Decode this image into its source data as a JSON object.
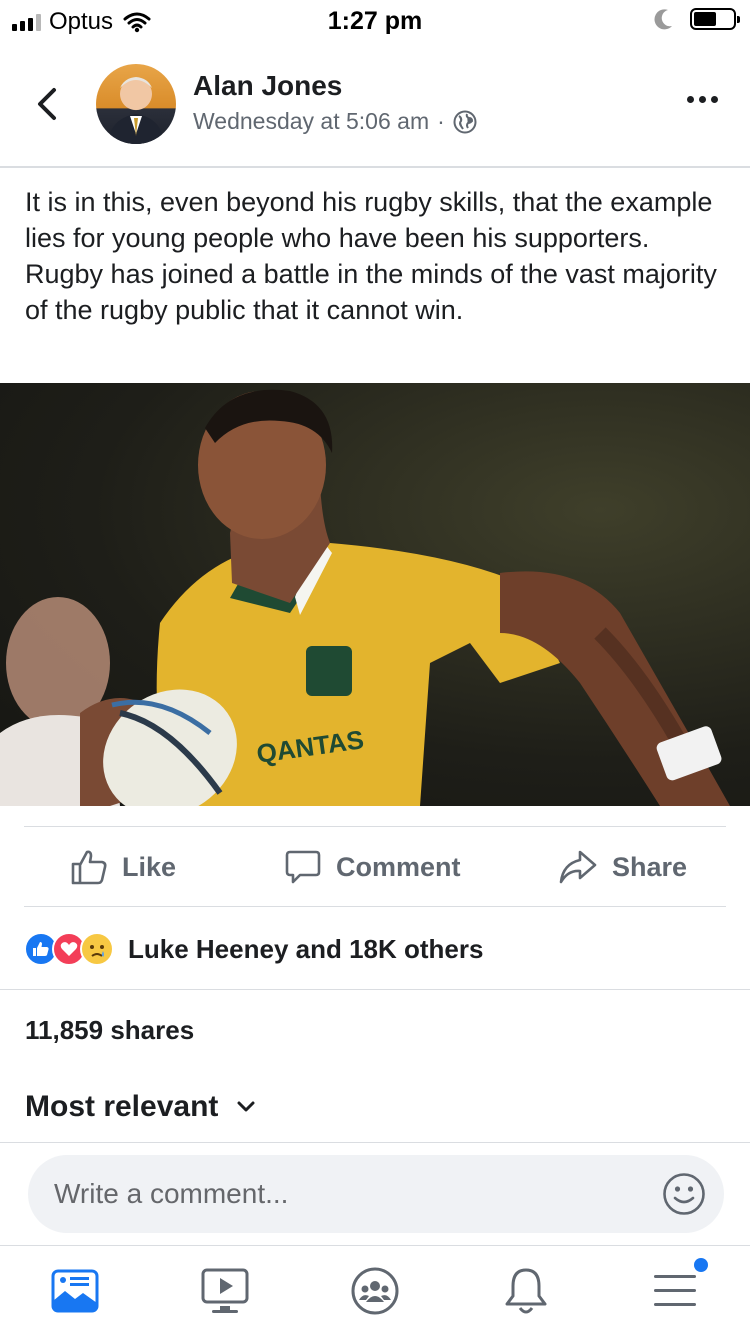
{
  "status_bar": {
    "carrier": "Optus",
    "time": "1:27 pm"
  },
  "post": {
    "author": "Alan Jones",
    "timestamp": "Wednesday at 5:06 am",
    "separator": "·",
    "text": "It is in this, even beyond his rugby skills, that the example lies for young people who have been his supporters. Rugby has joined a battle in the minds of the vast majority of the rugby public that it cannot win.",
    "photo_label": "QANTAS"
  },
  "actions": {
    "like": "Like",
    "comment": "Comment",
    "share": "Share"
  },
  "reactions": {
    "summary": "Luke Heeney and 18K others",
    "icons": [
      "like-reaction-icon",
      "love-reaction-icon",
      "sad-reaction-icon"
    ]
  },
  "shares": "11,859 shares",
  "comments": {
    "sort_label": "Most relevant",
    "placeholder": "Write a comment..."
  },
  "tab_bar": {
    "items": [
      "news-feed-icon",
      "watch-icon",
      "groups-icon",
      "notifications-icon",
      "menu-icon"
    ]
  },
  "colors": {
    "brand_blue": "#1877f2",
    "love_red": "#f33e58",
    "secondary_text": "#606770"
  }
}
